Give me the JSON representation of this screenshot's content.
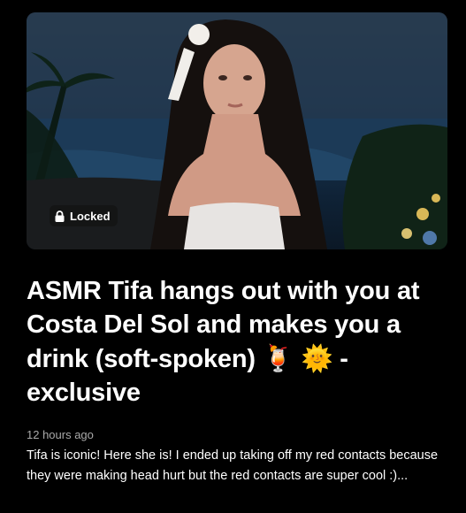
{
  "post": {
    "thumbnail": {
      "description_icon": "video-thumbnail",
      "locked_label": "Locked",
      "lock_icon": "lock-icon"
    },
    "title_text": "ASMR Tifa hangs out with you at Costa Del Sol and makes you a drink (soft-spoken) ",
    "title_emoji_1": "🍹",
    "title_emoji_2": "🌞",
    "title_suffix": " - exclusive",
    "timestamp": "12 hours ago",
    "description": "Tifa is iconic! Here she is! I ended up taking off my red contacts because they were making head hurt but the red contacts are super cool :)..."
  },
  "colors": {
    "background": "#000000",
    "title": "#ffffff",
    "timestamp": "#a9a9a9",
    "badge_bg": "#141414"
  }
}
